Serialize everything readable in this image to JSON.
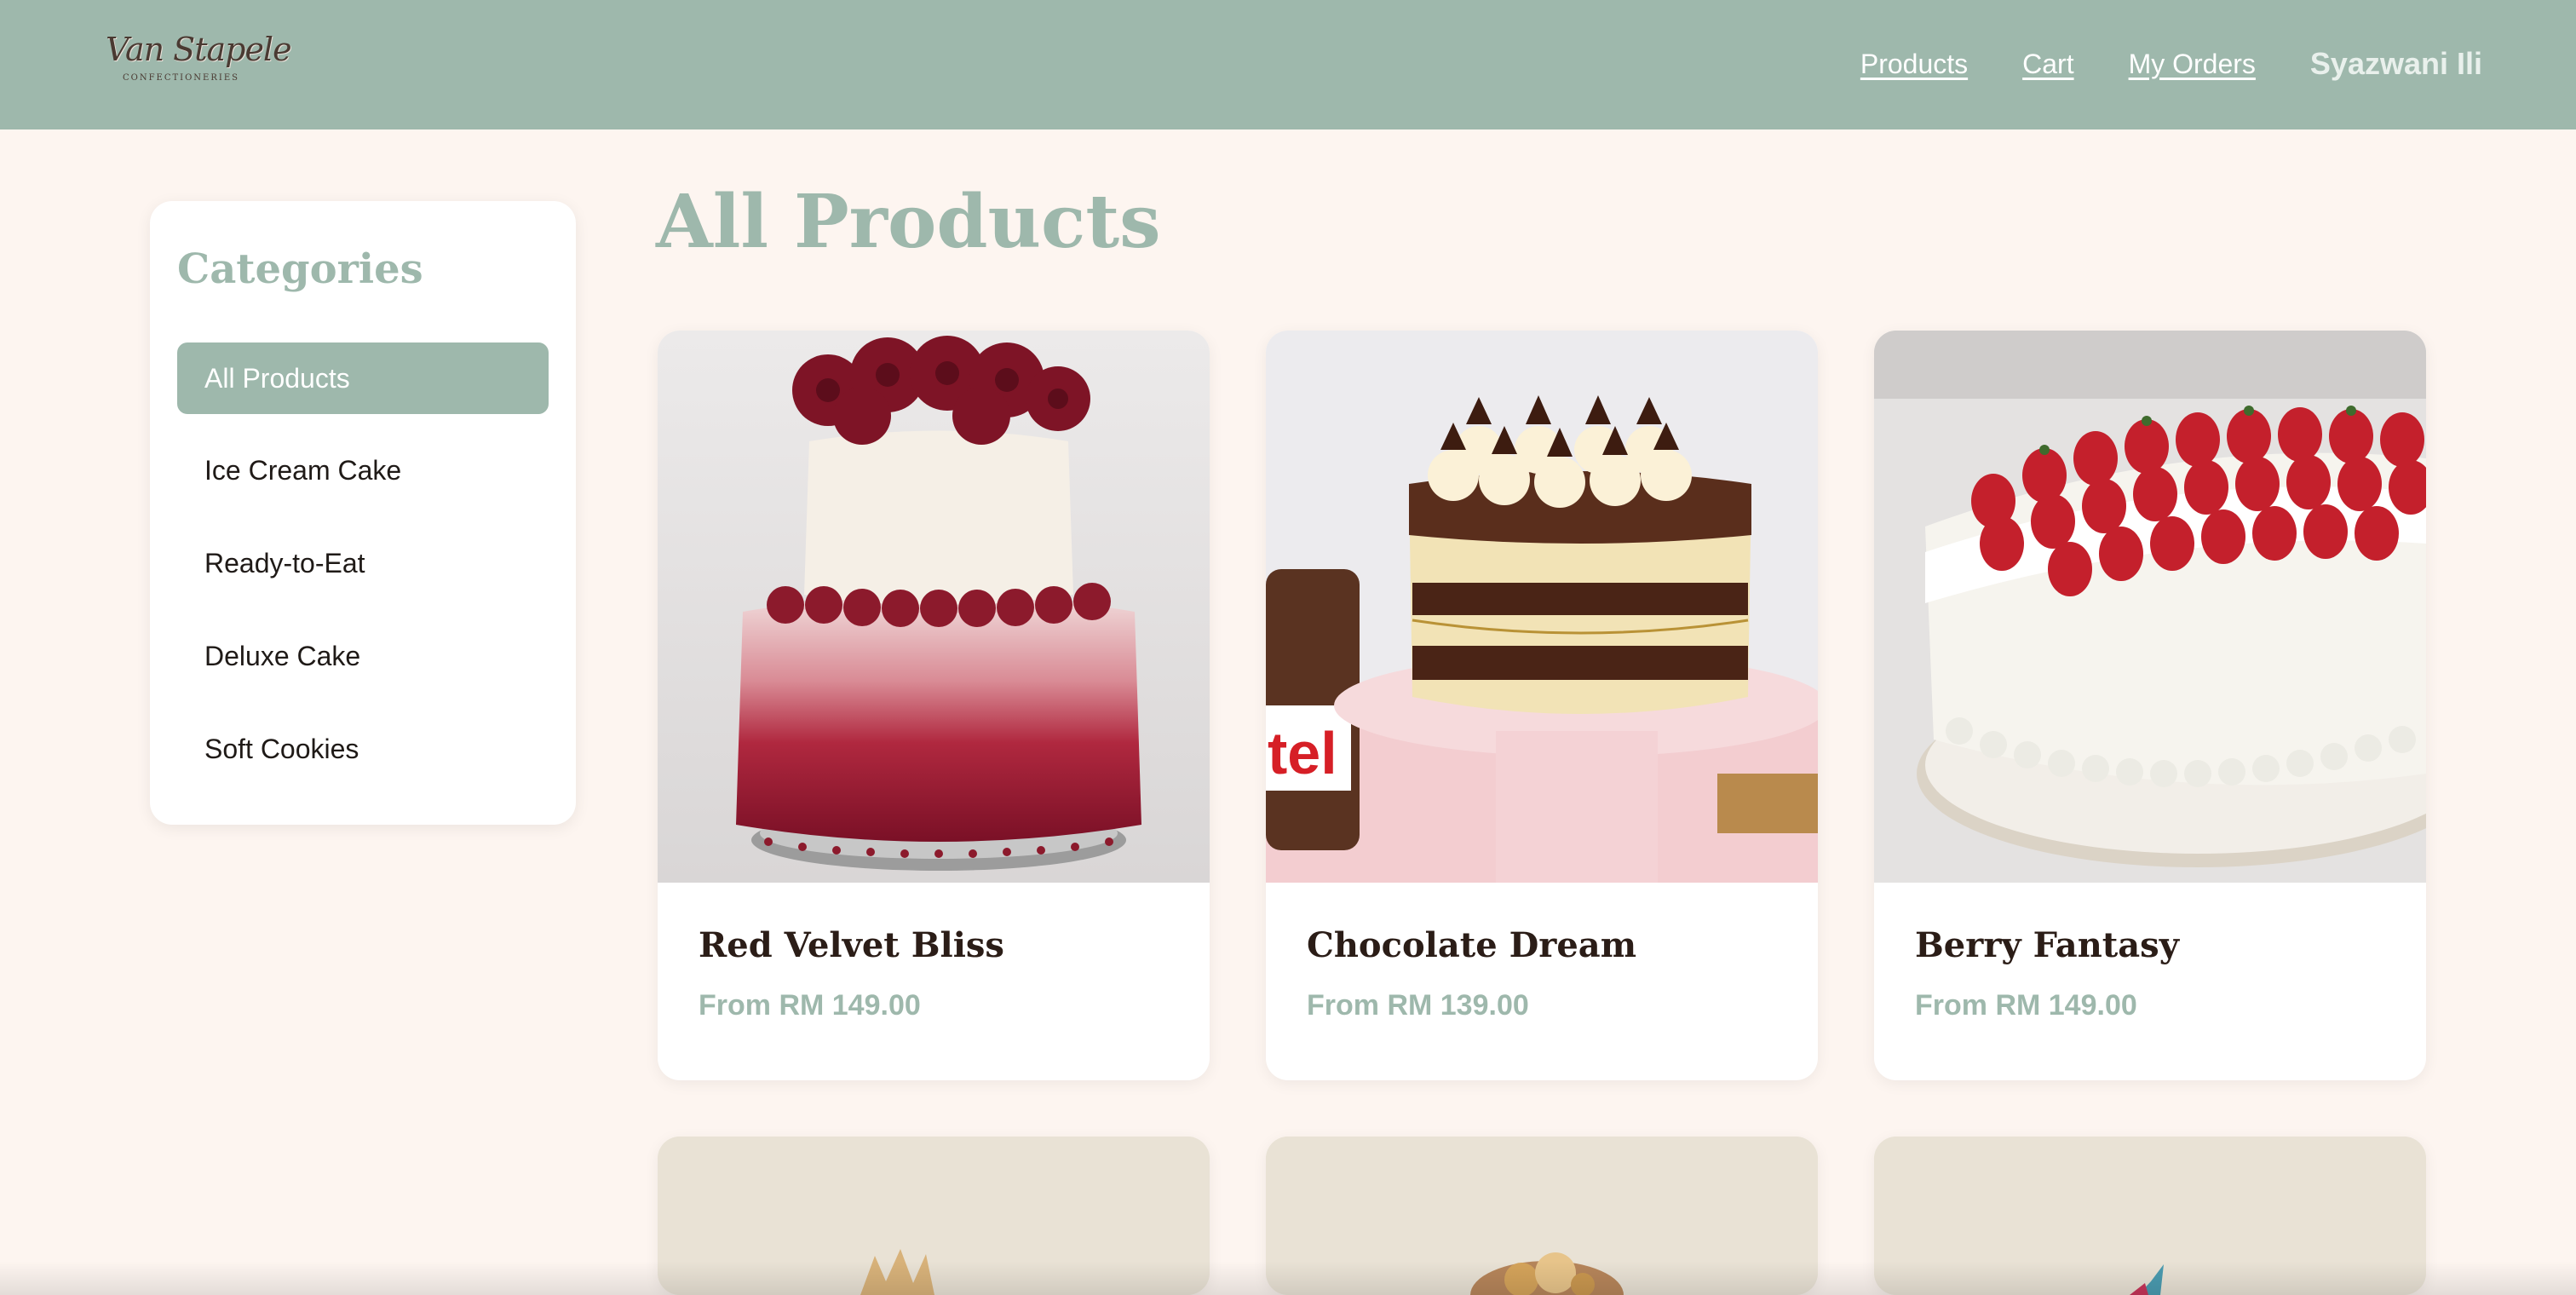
{
  "header": {
    "logo_text": "Van Stapele",
    "logo_subtext": "CONFECTIONERIES",
    "nav": [
      {
        "label": "Products"
      },
      {
        "label": "Cart"
      },
      {
        "label": "My Orders"
      }
    ],
    "user_name": "Syazwani Ili"
  },
  "sidebar": {
    "title": "Categories",
    "items": [
      {
        "label": "All Products",
        "active": true
      },
      {
        "label": "Ice Cream Cake",
        "active": false
      },
      {
        "label": "Ready-to-Eat",
        "active": false
      },
      {
        "label": "Deluxe Cake",
        "active": false
      },
      {
        "label": "Soft Cookies",
        "active": false
      }
    ]
  },
  "main": {
    "title": "All Products",
    "products": [
      {
        "name": "Red Velvet Bliss",
        "price": "From RM 149.00"
      },
      {
        "name": "Chocolate Dream",
        "price": "From RM 139.00"
      },
      {
        "name": "Berry Fantasy",
        "price": "From RM 149.00"
      },
      {
        "name": "",
        "price": ""
      },
      {
        "name": "",
        "price": ""
      },
      {
        "name": "",
        "price": ""
      }
    ]
  },
  "colors": {
    "accent": "#9eb8ac",
    "page_bg": "#fdf5f0",
    "text_dark": "#2b1d17"
  }
}
